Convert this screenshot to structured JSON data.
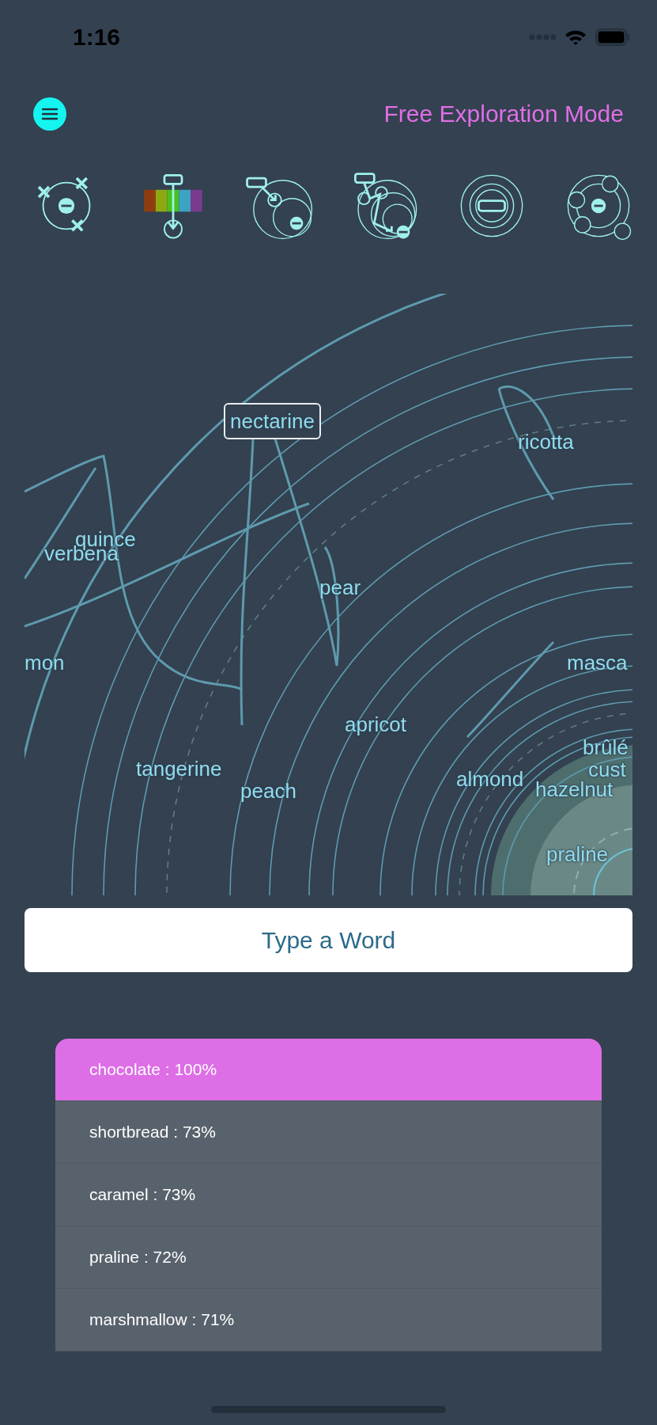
{
  "status_bar": {
    "time": "1:16"
  },
  "header": {
    "title": "Free Exploration Mode"
  },
  "toolbar": [
    {
      "kind": "scatter"
    },
    {
      "kind": "spectrum"
    },
    {
      "kind": "path"
    },
    {
      "kind": "chain"
    },
    {
      "kind": "target"
    },
    {
      "kind": "orbit"
    }
  ],
  "map": {
    "words": [
      {
        "text": "nectarine",
        "selected": true
      },
      {
        "text": "ricotta",
        "selected": false
      },
      {
        "text": "quince",
        "selected": false
      },
      {
        "text": "verbena",
        "selected": false
      },
      {
        "text": "pear",
        "selected": false
      },
      {
        "text": "mon",
        "selected": false
      },
      {
        "text": "masca",
        "selected": false
      },
      {
        "text": "apricot",
        "selected": false
      },
      {
        "text": "tangerine",
        "selected": false
      },
      {
        "text": "peach",
        "selected": false
      },
      {
        "text": "almond",
        "selected": false
      },
      {
        "text": "hazelnut",
        "selected": false
      },
      {
        "text": "brûlé",
        "selected": false
      },
      {
        "text": "cust",
        "selected": false
      },
      {
        "text": "praline",
        "selected": false
      }
    ]
  },
  "input": {
    "placeholder": "Type a Word"
  },
  "results": [
    {
      "text": "chocolate : 100%",
      "selected": true
    },
    {
      "text": "shortbread : 73%",
      "selected": false
    },
    {
      "text": "caramel : 73%",
      "selected": false
    },
    {
      "text": "praline : 72%",
      "selected": false
    },
    {
      "text": "marshmallow : 71%",
      "selected": false
    }
  ]
}
